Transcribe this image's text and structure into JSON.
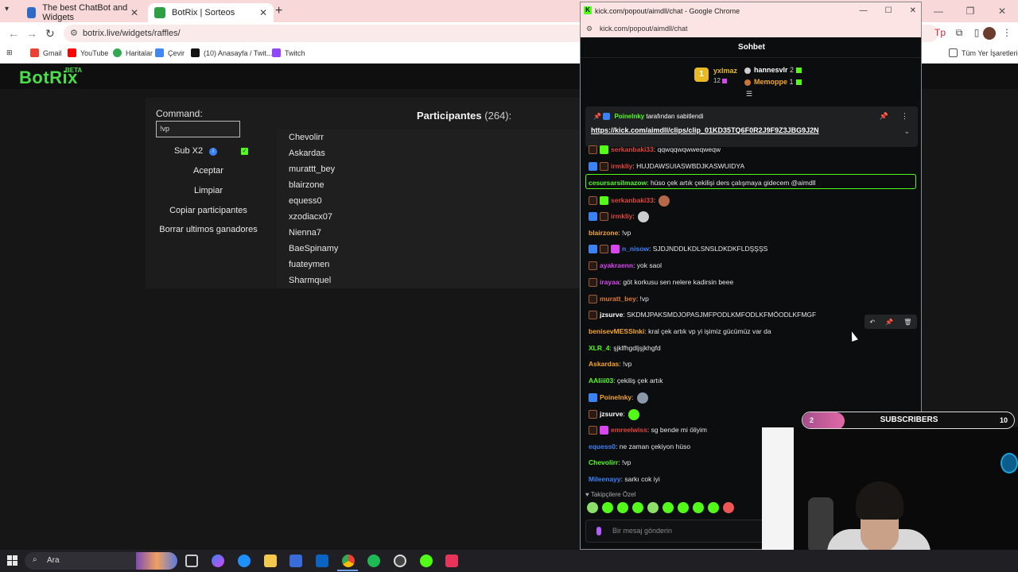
{
  "browser": {
    "tabs": [
      {
        "title": "The best ChatBot and Widgets",
        "favicon_color": "#2d6bc9",
        "active": false
      },
      {
        "title": "BotRix | Sorteos",
        "favicon_color": "#2ea043",
        "active": true
      }
    ],
    "url": "botrix.live/widgets/raffles/",
    "bookmarks": [
      {
        "label": "Gmail",
        "color": "#ea4335"
      },
      {
        "label": "YouTube",
        "color": "#ff0000"
      },
      {
        "label": "Haritalar",
        "color": "#34a853"
      },
      {
        "label": "Çevir",
        "color": "#4285f4"
      },
      {
        "label": "(10) Anasayfa / Twit...",
        "color": "#111111"
      },
      {
        "label": "Twitch",
        "color": "#9146ff"
      }
    ],
    "all_bookmarks": "Tüm Yer İşaretleri"
  },
  "botrix": {
    "logo": "BotRix",
    "logo_badge": "BETA",
    "command_label": "Command:",
    "command_value": "!vp",
    "sub_label": "Sub X2",
    "buttons": {
      "accept": "Aceptar",
      "clear": "Limpiar",
      "copy": "Copiar participantes",
      "delete_winners": "Borrar ultimos ganadores"
    },
    "participants_title": "Participantes",
    "participants_count": "(264):",
    "participants": [
      "Chevolirr",
      "Askardas",
      "murattt_bey",
      "blairzone",
      "equess0",
      "xzodiacx07",
      "Nienna7",
      "BaeSpinamy",
      "fuateymen",
      "Sharmquel"
    ]
  },
  "popup": {
    "title": "kick.com/popout/aimdll/chat - Google Chrome",
    "url": "kick.com/popout/aimdll/chat",
    "chat_header": "Sohbet",
    "leaderboard": {
      "first": {
        "name": "yxlmaz",
        "count": "12",
        "rank": "1"
      },
      "second": {
        "name": "hannesvlr",
        "count": "2"
      },
      "third": {
        "name": "Memoppe",
        "count": "1"
      }
    },
    "pinned": {
      "user": "Poinelnky",
      "suffix": "tarafından sabitlendi",
      "link": "https://kick.com/aimdll/clips/clip_01KD35TQ6F0R2J9F9Z3JBG9J2N"
    },
    "messages": [
      {
        "user": "serkanbaki33",
        "color": "#e0453a",
        "text": ": qqwqqwqwweqweqw"
      },
      {
        "user": "irmkliy",
        "color": "#e0453a",
        "text": ": HUJDAWSUIASWBDJKASWUIDYA"
      },
      {
        "user": "cesursarsilmazow",
        "color": "#53fc18",
        "text": ": hüso çek artık çekilişi ders çalışmaya gidecem @aimdll"
      },
      {
        "user": "serkanbaki33",
        "color": "#e0453a",
        "text": ":"
      },
      {
        "user": "irmkliy",
        "color": "#e0453a",
        "text": ":"
      },
      {
        "user": "blairzone",
        "color": "#f5a623",
        "text": ": !vp"
      },
      {
        "user": "n_nisow",
        "color": "#3b82f6",
        "text": ": SJDJNDDLKDLSNSLDKDKFLDŞŞŞS"
      },
      {
        "user": "ayakraenn",
        "color": "#d946ef",
        "text": ": yok saol"
      },
      {
        "user": "irayaa",
        "color": "#d946ef",
        "text": ": göt korkusu sen nelere kadirsin beee"
      },
      {
        "user": "muratt_bey",
        "color": "#e07b2a",
        "text": ": !vp"
      },
      {
        "user": "jzsurve",
        "color": "#ffffff",
        "text": ": SKDMJPAKSMDJOPASJMFPODLKMFODLKFMÖODLKFMGF"
      },
      {
        "user": "benisevMESSInki",
        "color": "#f5a623",
        "text": ": kral çek artık vp yi işimiz gücümüz var da"
      },
      {
        "user": "XLR_4",
        "color": "#53fc18",
        "text": ": şjklfhgdljşjkhgfd"
      },
      {
        "user": "Askardas",
        "color": "#f5a623",
        "text": ": !vp"
      },
      {
        "user": "AAliii03",
        "color": "#53fc18",
        "text": ": çekiliş çek artık"
      },
      {
        "user": "Poinelnky",
        "color": "#f5a623",
        "text": ":"
      },
      {
        "user": "jzsurve",
        "color": "#ffffff",
        "text": ":"
      },
      {
        "user": "emreelwiss",
        "color": "#e0453a",
        "text": ": sg bende mi öliyim"
      },
      {
        "user": "equess0",
        "color": "#3b82f6",
        "text": ": ne zaman çekiyon hüso"
      },
      {
        "user": "Chevolirr",
        "color": "#53fc18",
        "text": ": !vp"
      },
      {
        "user": "Mileenayy",
        "color": "#3b82f6",
        "text": ": sarkı cok iyi"
      }
    ],
    "followers_only": "Takipçilere Özel",
    "input_placeholder": "Bir mesaj gönderin"
  },
  "overlay": {
    "subs_label": "SUBSCRIBERS",
    "subs_current": "2",
    "subs_goal": "10",
    "subs_progress": 0.2
  },
  "taskbar": {
    "search_placeholder": "Ara"
  }
}
